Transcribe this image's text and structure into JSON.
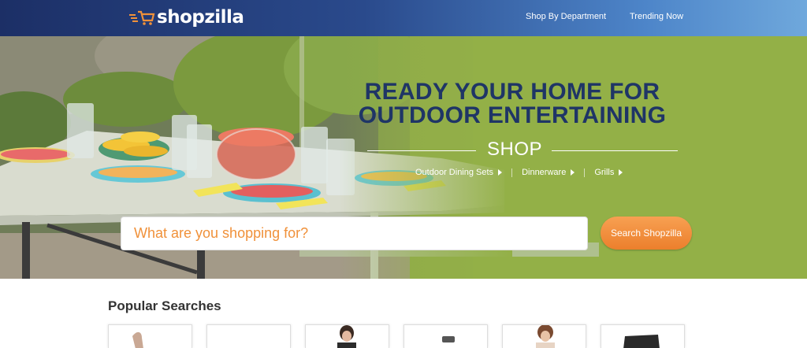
{
  "header": {
    "logo_text": "shopzilla",
    "nav": [
      {
        "label": "Shop By Department"
      },
      {
        "label": "Trending Now"
      }
    ]
  },
  "hero": {
    "title_line1": "READY YOUR HOME FOR",
    "title_line2": "OUTDOOR ENTERTAINING",
    "shop_label": "SHOP",
    "categories": [
      {
        "label": "Outdoor Dining Sets"
      },
      {
        "label": "Dinnerware"
      },
      {
        "label": "Grills"
      }
    ]
  },
  "search": {
    "placeholder": "What are you shopping for?",
    "button_label": "Search Shopzilla"
  },
  "popular": {
    "title": "Popular Searches",
    "items": [
      {
        "icon": "shoe-thumbnail"
      },
      {
        "icon": "blank-thumbnail"
      },
      {
        "icon": "woman-thumbnail"
      },
      {
        "icon": "camera-thumbnail"
      },
      {
        "icon": "woman-thumbnail"
      },
      {
        "icon": "laptop-thumbnail"
      }
    ]
  },
  "colors": {
    "header_dark": "#1c2f66",
    "header_light": "#6fa8dc",
    "hero_title": "#1f3566",
    "accent_orange": "#ec7f2c",
    "hero_green": "#93b047"
  }
}
